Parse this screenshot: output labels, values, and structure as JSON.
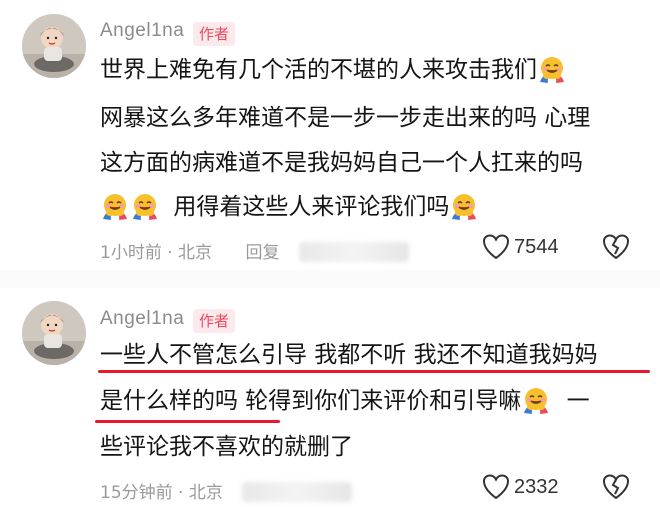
{
  "comments": [
    {
      "username": "Angel1na",
      "badge": "作者",
      "lines": [
        "世界上难免有几个活的不堪的人来攻击我们",
        "网暴这么多年难道不是一步一步走出来的吗 心理",
        "这方面的病难道不是我妈妈自己一个人扛来的吗",
        "用得着这些人来评论我们吗"
      ],
      "time": "1小时前",
      "location": "北京",
      "reply_fragment": "回复",
      "likes": "7544"
    },
    {
      "username": "Angel1na",
      "badge": "作者",
      "lines": [
        "一些人不管怎么引导 我都不听 我还不知道我妈妈",
        "是什么样的吗 轮得到你们来评价和引导嘛",
        "一",
        "些评论我不喜欢的就删了"
      ],
      "time": "15分钟前",
      "location": "北京",
      "likes": "2332"
    }
  ],
  "icons": {
    "emoji": "hugging-face-emoji",
    "like": "heart-outline-icon",
    "dislike": "broken-heart-icon"
  },
  "colors": {
    "badge_bg": "#fce9ec",
    "badge_text": "#e84a5f",
    "underline": "#e8182d"
  }
}
